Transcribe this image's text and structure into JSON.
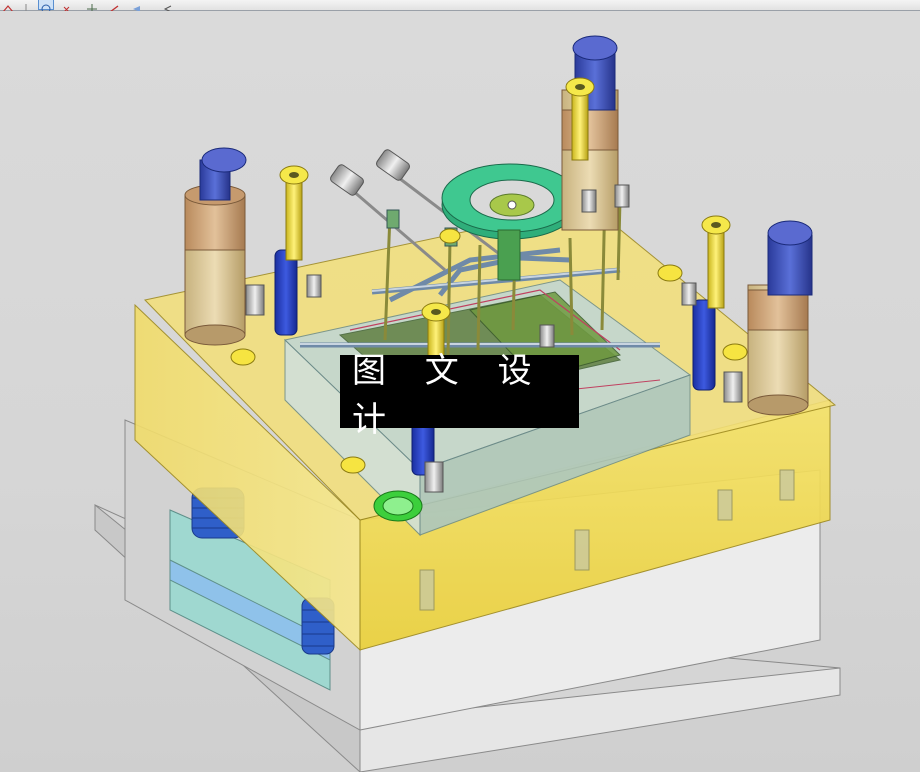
{
  "toolbar": {
    "buttons": [
      {
        "name": "cut-icon"
      },
      {
        "name": "rotate-view-icon",
        "selected": true
      },
      {
        "name": "undo-icon"
      },
      {
        "name": "pan-icon"
      },
      {
        "name": "zoom-icon"
      },
      {
        "name": "back-arrow-icon"
      },
      {
        "name": "dropdown-arrow-icon"
      }
    ]
  },
  "viewport": {
    "background": "#d9d9d9",
    "watermark_text": "图 文 设 计"
  },
  "colors": {
    "clamp_plate": "#f2e07a",
    "plate_gray": "#e8e8e8",
    "leader_pin": "#3b4fb0",
    "bushing": "#c9a47e",
    "locating_ring": "#2fae7a",
    "screw_yellow": "#f5e84a",
    "spring_blue": "#2f5fc9",
    "sprue_green": "#3ccf3c",
    "cavity_teal": "#9fd8d0"
  }
}
